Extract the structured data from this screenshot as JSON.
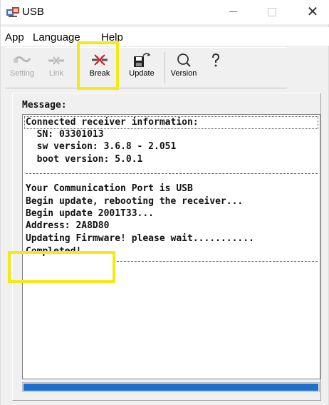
{
  "window": {
    "title": "USB",
    "close_glyph": "✕"
  },
  "menu": {
    "items": [
      "App",
      "Language",
      "Help"
    ]
  },
  "toolbar": {
    "items": [
      {
        "label": "Setting",
        "icon": "cable-icon",
        "enabled": false
      },
      {
        "label": "Link",
        "icon": "link-icon",
        "enabled": false
      },
      {
        "label": "Break",
        "icon": "break-icon",
        "enabled": true
      },
      {
        "label": "Update",
        "icon": "save-update-icon",
        "enabled": true
      },
      {
        "label": "Version",
        "icon": "magnifier-icon",
        "enabled": true
      },
      {
        "label": "",
        "icon": "help-question-icon",
        "enabled": true
      }
    ]
  },
  "message": {
    "label": "Message:",
    "lines": [
      "Connected receiver information:",
      "  SN: 03301013",
      "  sw version: 3.6.8 - 2.051",
      "  boot version: 5.0.1",
      "Your Communication Port is USB",
      "Begin update, rebooting the receiver...",
      "Begin update 2001T33...",
      "Address: 2A8D80",
      "Updating Firmware! please wait...........",
      "Completed!"
    ]
  },
  "progress": {
    "value": 1.0
  },
  "colors": {
    "highlight": "#f2ea14",
    "progress": "#1f6fcf"
  }
}
